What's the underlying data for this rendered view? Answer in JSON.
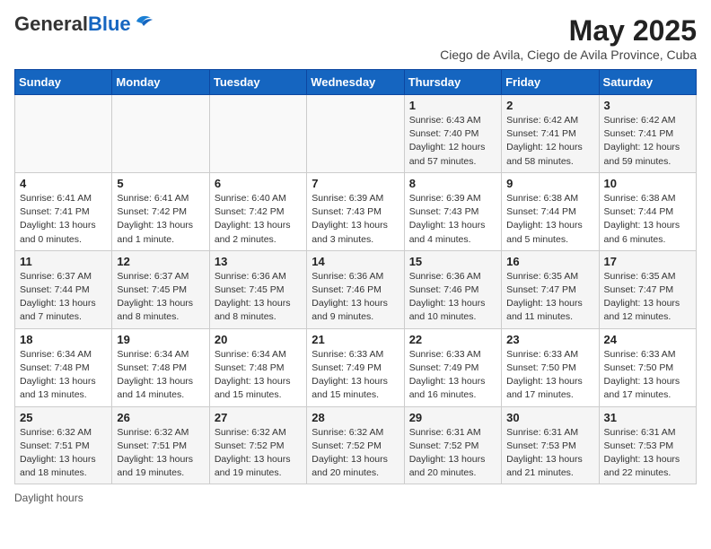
{
  "logo": {
    "general": "General",
    "blue": "Blue"
  },
  "title": "May 2025",
  "subtitle": "Ciego de Avila, Ciego de Avila Province, Cuba",
  "days_of_week": [
    "Sunday",
    "Monday",
    "Tuesday",
    "Wednesday",
    "Thursday",
    "Friday",
    "Saturday"
  ],
  "footer": "Daylight hours",
  "weeks": [
    [
      {
        "day": "",
        "info": ""
      },
      {
        "day": "",
        "info": ""
      },
      {
        "day": "",
        "info": ""
      },
      {
        "day": "",
        "info": ""
      },
      {
        "day": "1",
        "info": "Sunrise: 6:43 AM\nSunset: 7:40 PM\nDaylight: 12 hours and 57 minutes."
      },
      {
        "day": "2",
        "info": "Sunrise: 6:42 AM\nSunset: 7:41 PM\nDaylight: 12 hours and 58 minutes."
      },
      {
        "day": "3",
        "info": "Sunrise: 6:42 AM\nSunset: 7:41 PM\nDaylight: 12 hours and 59 minutes."
      }
    ],
    [
      {
        "day": "4",
        "info": "Sunrise: 6:41 AM\nSunset: 7:41 PM\nDaylight: 13 hours and 0 minutes."
      },
      {
        "day": "5",
        "info": "Sunrise: 6:41 AM\nSunset: 7:42 PM\nDaylight: 13 hours and 1 minute."
      },
      {
        "day": "6",
        "info": "Sunrise: 6:40 AM\nSunset: 7:42 PM\nDaylight: 13 hours and 2 minutes."
      },
      {
        "day": "7",
        "info": "Sunrise: 6:39 AM\nSunset: 7:43 PM\nDaylight: 13 hours and 3 minutes."
      },
      {
        "day": "8",
        "info": "Sunrise: 6:39 AM\nSunset: 7:43 PM\nDaylight: 13 hours and 4 minutes."
      },
      {
        "day": "9",
        "info": "Sunrise: 6:38 AM\nSunset: 7:44 PM\nDaylight: 13 hours and 5 minutes."
      },
      {
        "day": "10",
        "info": "Sunrise: 6:38 AM\nSunset: 7:44 PM\nDaylight: 13 hours and 6 minutes."
      }
    ],
    [
      {
        "day": "11",
        "info": "Sunrise: 6:37 AM\nSunset: 7:44 PM\nDaylight: 13 hours and 7 minutes."
      },
      {
        "day": "12",
        "info": "Sunrise: 6:37 AM\nSunset: 7:45 PM\nDaylight: 13 hours and 8 minutes."
      },
      {
        "day": "13",
        "info": "Sunrise: 6:36 AM\nSunset: 7:45 PM\nDaylight: 13 hours and 8 minutes."
      },
      {
        "day": "14",
        "info": "Sunrise: 6:36 AM\nSunset: 7:46 PM\nDaylight: 13 hours and 9 minutes."
      },
      {
        "day": "15",
        "info": "Sunrise: 6:36 AM\nSunset: 7:46 PM\nDaylight: 13 hours and 10 minutes."
      },
      {
        "day": "16",
        "info": "Sunrise: 6:35 AM\nSunset: 7:47 PM\nDaylight: 13 hours and 11 minutes."
      },
      {
        "day": "17",
        "info": "Sunrise: 6:35 AM\nSunset: 7:47 PM\nDaylight: 13 hours and 12 minutes."
      }
    ],
    [
      {
        "day": "18",
        "info": "Sunrise: 6:34 AM\nSunset: 7:48 PM\nDaylight: 13 hours and 13 minutes."
      },
      {
        "day": "19",
        "info": "Sunrise: 6:34 AM\nSunset: 7:48 PM\nDaylight: 13 hours and 14 minutes."
      },
      {
        "day": "20",
        "info": "Sunrise: 6:34 AM\nSunset: 7:48 PM\nDaylight: 13 hours and 15 minutes."
      },
      {
        "day": "21",
        "info": "Sunrise: 6:33 AM\nSunset: 7:49 PM\nDaylight: 13 hours and 15 minutes."
      },
      {
        "day": "22",
        "info": "Sunrise: 6:33 AM\nSunset: 7:49 PM\nDaylight: 13 hours and 16 minutes."
      },
      {
        "day": "23",
        "info": "Sunrise: 6:33 AM\nSunset: 7:50 PM\nDaylight: 13 hours and 17 minutes."
      },
      {
        "day": "24",
        "info": "Sunrise: 6:33 AM\nSunset: 7:50 PM\nDaylight: 13 hours and 17 minutes."
      }
    ],
    [
      {
        "day": "25",
        "info": "Sunrise: 6:32 AM\nSunset: 7:51 PM\nDaylight: 13 hours and 18 minutes."
      },
      {
        "day": "26",
        "info": "Sunrise: 6:32 AM\nSunset: 7:51 PM\nDaylight: 13 hours and 19 minutes."
      },
      {
        "day": "27",
        "info": "Sunrise: 6:32 AM\nSunset: 7:52 PM\nDaylight: 13 hours and 19 minutes."
      },
      {
        "day": "28",
        "info": "Sunrise: 6:32 AM\nSunset: 7:52 PM\nDaylight: 13 hours and 20 minutes."
      },
      {
        "day": "29",
        "info": "Sunrise: 6:31 AM\nSunset: 7:52 PM\nDaylight: 13 hours and 20 minutes."
      },
      {
        "day": "30",
        "info": "Sunrise: 6:31 AM\nSunset: 7:53 PM\nDaylight: 13 hours and 21 minutes."
      },
      {
        "day": "31",
        "info": "Sunrise: 6:31 AM\nSunset: 7:53 PM\nDaylight: 13 hours and 22 minutes."
      }
    ]
  ]
}
